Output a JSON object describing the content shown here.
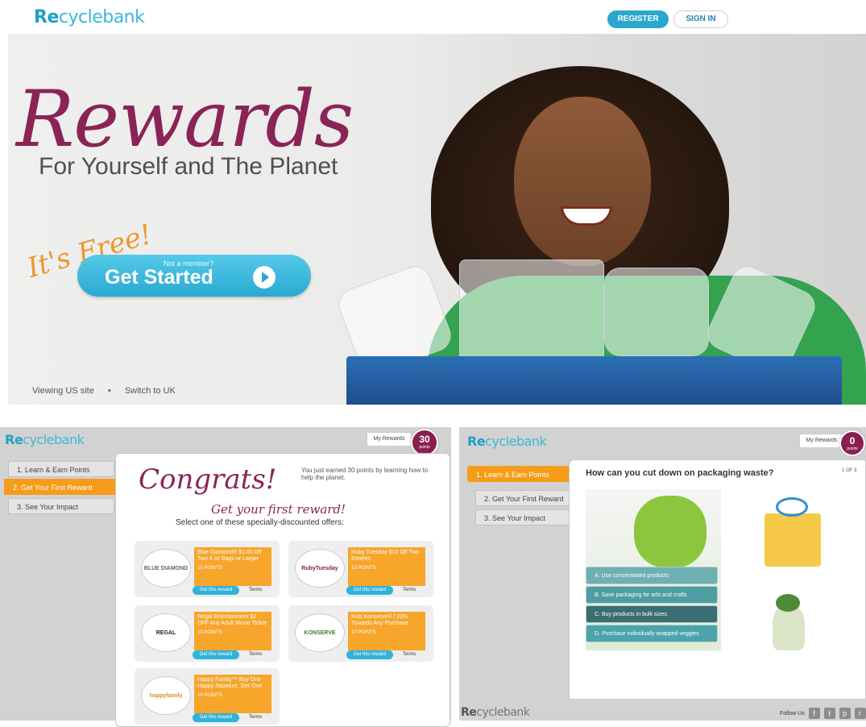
{
  "top": {
    "logo": {
      "re": "Re",
      "rest": "cyclebank"
    },
    "register": "REGISTER",
    "signin": "SIGN IN",
    "hero_title": "Rewards",
    "hero_subtitle": "For Yourself and The Planet",
    "hero_free": "It's Free!",
    "cta_small": "Not a member?",
    "cta_main": "Get Started",
    "viewing": "Viewing US site",
    "bullet": "•",
    "switch": "Switch to UK"
  },
  "left_panel": {
    "logo": {
      "re": "Re",
      "rest": "cyclebank"
    },
    "my_rewards": "My Rewards",
    "points": "30",
    "points_label": "points",
    "steps": [
      "1. Learn & Earn Points",
      "2. Get Your First Reward",
      "3. See Your Impact"
    ],
    "congrats": "Congrats!",
    "earned_text": "You just earned 30 points by learning how to help the planet.",
    "get_reward_heading": "Get your first reward!",
    "select_text": "Select one of these specially-discounted offers:",
    "rewards": [
      {
        "logo": "BLUE DIAMOND",
        "offer": "Blue Diamond® $1.00 Off Two 4 oz Bags or Larger",
        "points": "10 POINTS",
        "button": "Get this reward",
        "terms": "Terms"
      },
      {
        "logo": "RubyTuesday",
        "offer": "Ruby Tuesday $10 Off Two Entrées",
        "points": "10 POINTS",
        "button": "Get this reward",
        "terms": "Terms"
      },
      {
        "logo": "REGAL",
        "offer": "Regal Entertainment $2 OFF Any Adult Movie Ticket",
        "points": "10 POINTS",
        "button": "Get this reward",
        "terms": "Terms"
      },
      {
        "logo": "KONSERVE",
        "offer": "Kids Konserve® / 20% Towards Any Purchase",
        "points": "10 POINTS",
        "button": "Get this reward",
        "terms": "Terms"
      },
      {
        "logo": "happyfamily",
        "offer": "Happy Family™ Buy One Happy Squeeze, Get One",
        "points": "10 POINTS",
        "button": "Get this reward",
        "terms": "Terms"
      }
    ]
  },
  "right_panel": {
    "logo": {
      "re": "Re",
      "rest": "cyclebank"
    },
    "my_rewards": "My Rewards",
    "points": "0",
    "points_label": "points",
    "steps": [
      "1. Learn & Earn Points",
      "2. Get Your First Reward",
      "3. See Your Impact"
    ],
    "question": "How can you cut down on packaging waste?",
    "page_indicator": "1 OF 3",
    "options": [
      {
        "label": "A. Use concentrated products",
        "color": "#6fb0b3"
      },
      {
        "label": "B. Save packaging for arts and crafts",
        "color": "#4d9ea2"
      },
      {
        "label": "C. Buy products in bulk sizes",
        "color": "#3a6e73"
      },
      {
        "label": "D. Purchase individually wrapped veggies",
        "color": "#4aa4aa"
      }
    ],
    "footer_logo": {
      "re": "Re",
      "rest": "cyclebank"
    },
    "follow_us": "Follow Us",
    "social_icons": [
      "f",
      "t",
      "p",
      "r"
    ]
  },
  "colors": {
    "brand_blue": "#2ba6cd",
    "brand_maroon": "#8a2456",
    "accent_orange": "#f59c1a"
  }
}
